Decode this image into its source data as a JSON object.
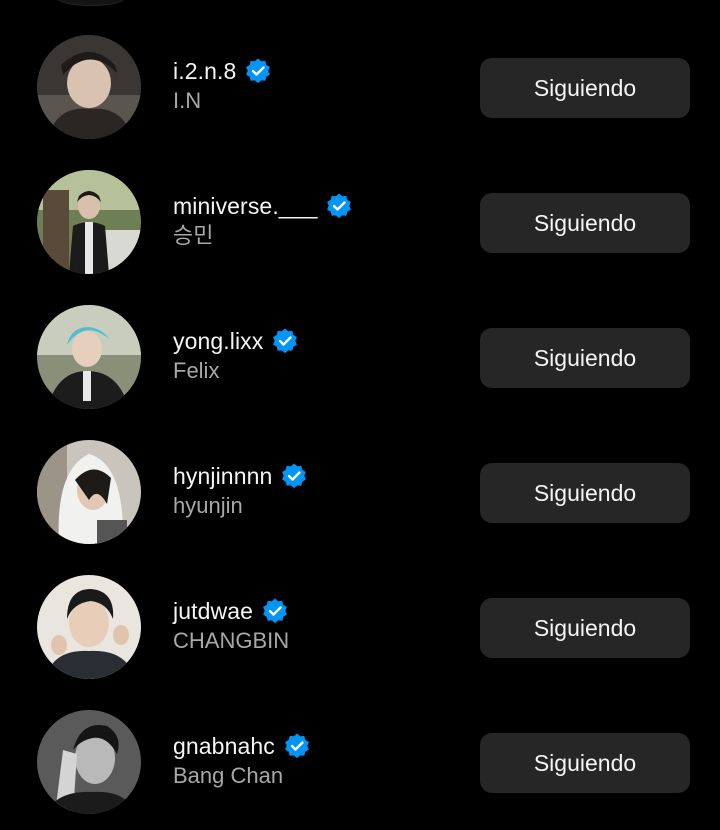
{
  "accent_color": "#0095f6",
  "button_bg": "#262626",
  "users": [
    {
      "username": "i.2.n.8",
      "fullname": "I.N",
      "verified": true,
      "button_label": "Siguiendo",
      "avatar_icon": "profile-photo"
    },
    {
      "username": "miniverse.___",
      "fullname": "승민",
      "verified": true,
      "button_label": "Siguiendo",
      "avatar_icon": "profile-photo"
    },
    {
      "username": "yong.lixx",
      "fullname": "Felix",
      "verified": true,
      "button_label": "Siguiendo",
      "avatar_icon": "profile-photo"
    },
    {
      "username": "hynjinnnn",
      "fullname": "hyunjin",
      "verified": true,
      "button_label": "Siguiendo",
      "avatar_icon": "profile-photo"
    },
    {
      "username": "jutdwae",
      "fullname": "CHANGBIN",
      "verified": true,
      "button_label": "Siguiendo",
      "avatar_icon": "profile-photo"
    },
    {
      "username": "gnabnahc",
      "fullname": "Bang Chan",
      "verified": true,
      "button_label": "Siguiendo",
      "avatar_icon": "profile-photo"
    }
  ]
}
